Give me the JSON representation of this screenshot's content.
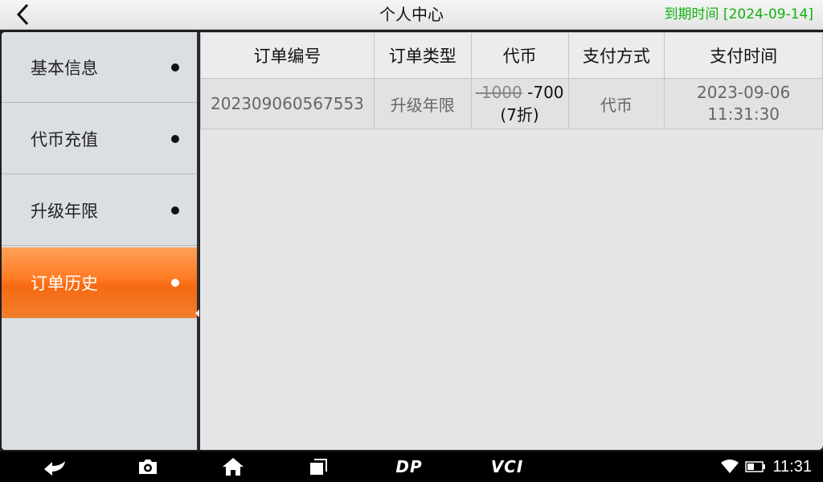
{
  "header": {
    "title": "个人中心",
    "expire_text": "到期时间 [2024-09-14]"
  },
  "sidebar": {
    "items": [
      {
        "label": "基本信息"
      },
      {
        "label": "代币充值"
      },
      {
        "label": "升级年限"
      },
      {
        "label": "订单历史",
        "active": true
      }
    ]
  },
  "orders": {
    "columns": [
      "订单编号",
      "订单类型",
      "代币",
      "支付方式",
      "支付时间"
    ],
    "rows": [
      {
        "order_no": "202309060567553",
        "type": "升级年限",
        "original_price": "-1000",
        "price": "-700",
        "discount": "(7折)",
        "pay_method": "代币",
        "pay_date": "2023-09-06",
        "pay_time": "11:31:30"
      }
    ]
  },
  "navbar": {
    "dp_label": "DP",
    "vci_label": "VCI",
    "clock": "11:31"
  },
  "colors": {
    "accent": "#ff7a22",
    "expire": "#12b212"
  }
}
